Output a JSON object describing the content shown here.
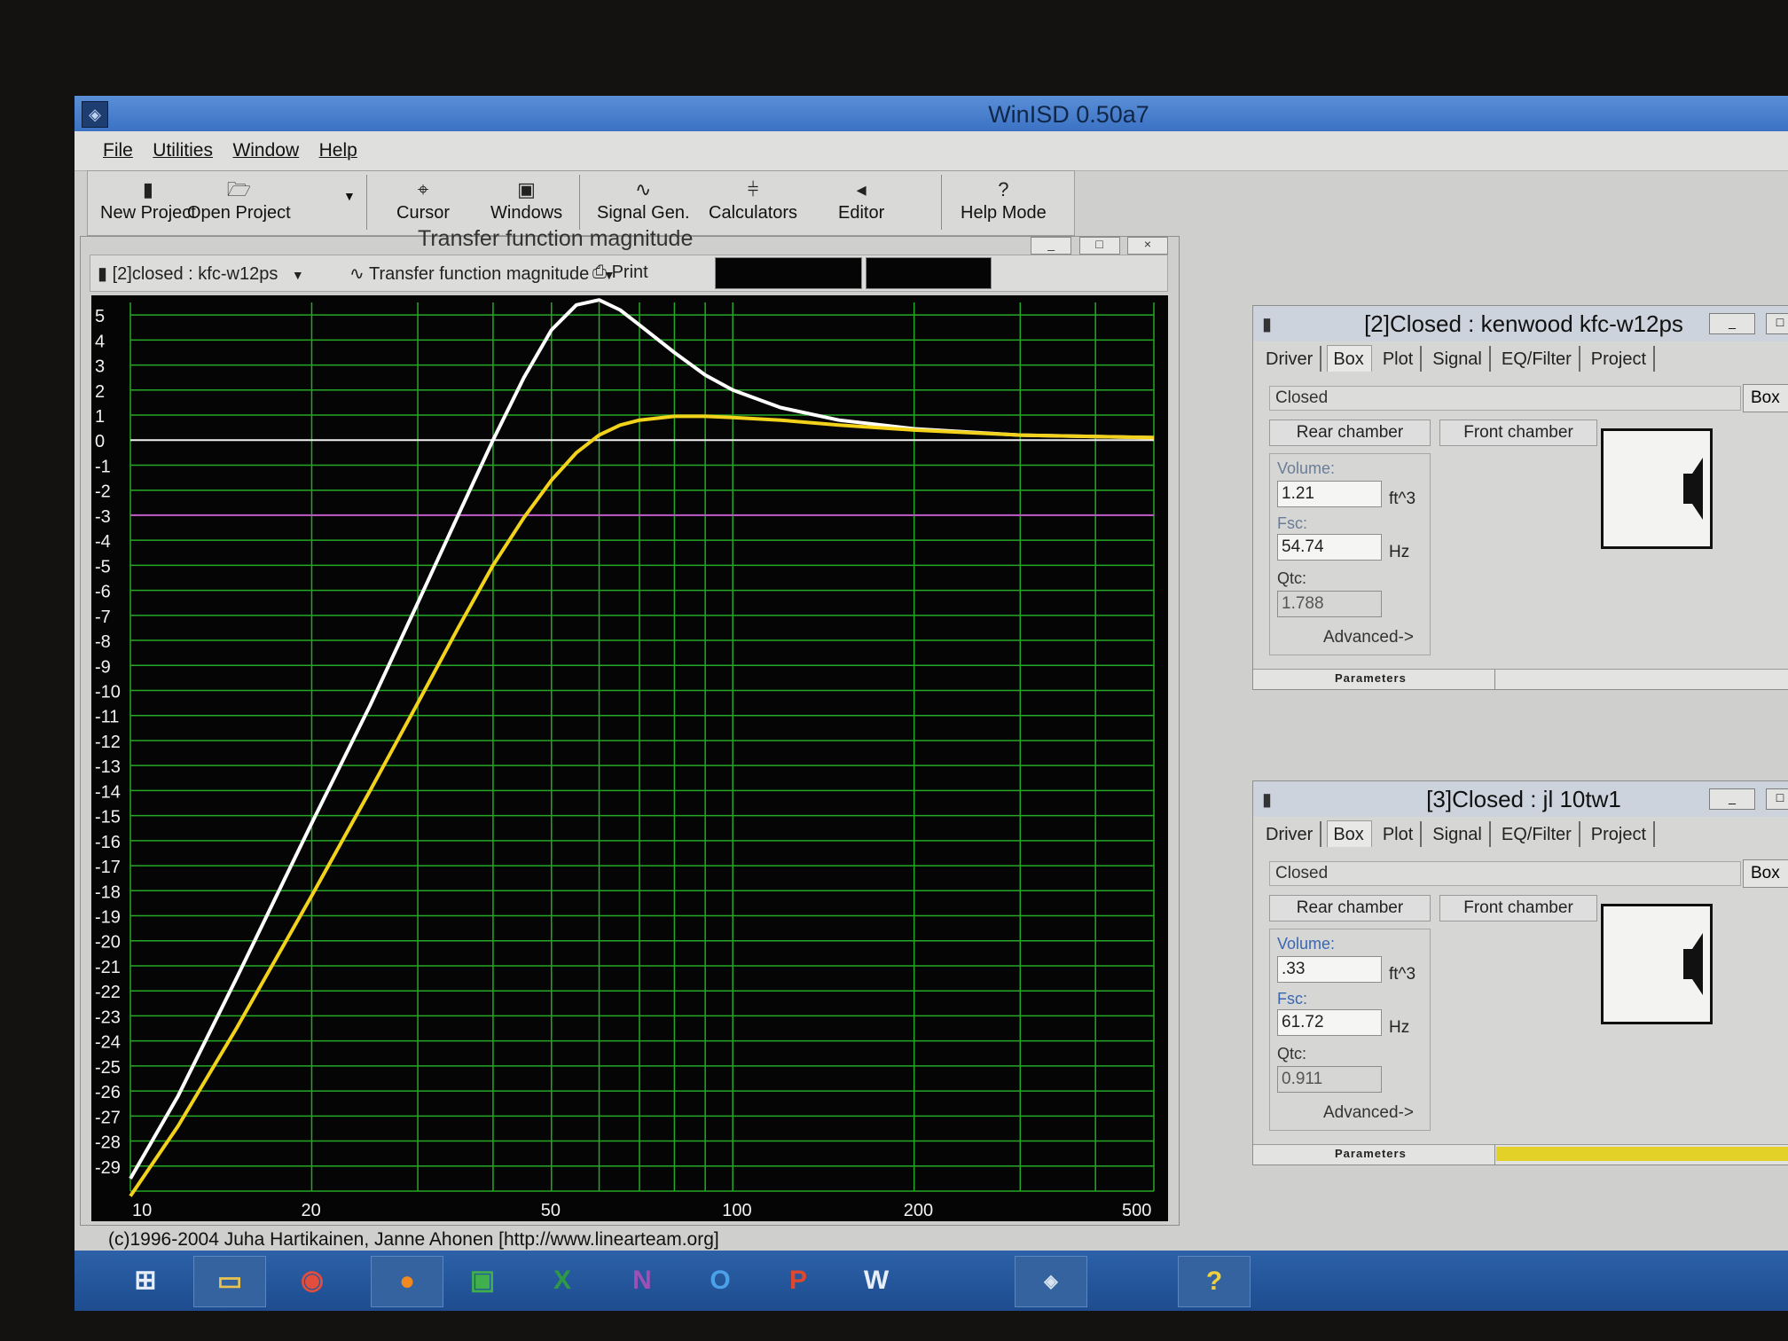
{
  "window": {
    "title": "WinISD 0.50a7"
  },
  "menu": [
    "File",
    "Utilities",
    "Window",
    "Help"
  ],
  "toolbar": {
    "new_project": "New Project",
    "open_project": "Open Project",
    "cursor": "Cursor",
    "windows": "Windows",
    "signal_gen": "Signal Gen.",
    "calculators": "Calculators",
    "editor": "Editor",
    "help_mode": "Help Mode"
  },
  "plot_window": {
    "title": "Transfer function magnitude",
    "project_select": "[2]closed : kfc-w12ps",
    "plot_type_select": "Transfer function magnitude",
    "print_label": "Print"
  },
  "chart_data": {
    "type": "line",
    "title": "Transfer function magnitude",
    "xscale": "log",
    "xlim": [
      10,
      500
    ],
    "ylim": [
      -30,
      5.5
    ],
    "x_tick_labels": [
      "10",
      "20",
      "50",
      "100",
      "200",
      "500"
    ],
    "y_tick_labels": [
      "5",
      "4",
      "3",
      "2",
      "1",
      "0",
      "-1",
      "-2",
      "-3",
      "-4",
      "-5",
      "-6",
      "-7",
      "-8",
      "-9",
      "-10",
      "-11",
      "-12",
      "-13",
      "-14",
      "-15",
      "-16",
      "-17",
      "-18",
      "-19",
      "-20",
      "-21",
      "-22",
      "-23",
      "-24",
      "-25",
      "-26",
      "-27",
      "-28",
      "-29"
    ],
    "grid": true,
    "reference_lines": [
      {
        "y": 0,
        "color": "#f0f0f0"
      },
      {
        "y": -3,
        "color": "#c05ac8"
      }
    ],
    "series": [
      {
        "color": "#ffffff",
        "x": [
          10,
          12,
          15,
          20,
          25,
          30,
          35,
          40,
          45,
          50,
          55,
          60,
          65,
          70,
          80,
          90,
          100,
          120,
          150,
          200,
          300,
          500
        ],
        "y": [
          -29.5,
          -26.2,
          -21.5,
          -15.3,
          -10.6,
          -6.5,
          -3.0,
          0.0,
          2.5,
          4.4,
          5.4,
          5.6,
          5.2,
          4.6,
          3.5,
          2.6,
          2.0,
          1.3,
          0.8,
          0.45,
          0.2,
          0.1
        ]
      },
      {
        "color": "#f2d21b",
        "x": [
          10,
          12,
          15,
          20,
          25,
          30,
          35,
          40,
          45,
          50,
          55,
          60,
          65,
          70,
          80,
          90,
          100,
          120,
          150,
          200,
          300,
          500
        ],
        "y": [
          -30.2,
          -27.4,
          -23.5,
          -18.2,
          -14.0,
          -10.5,
          -7.5,
          -5.0,
          -3.1,
          -1.6,
          -0.5,
          0.2,
          0.6,
          0.8,
          0.95,
          0.95,
          0.9,
          0.8,
          0.6,
          0.4,
          0.2,
          0.1
        ]
      }
    ]
  },
  "panels": [
    {
      "title": "[2]Closed : kenwood kfc-w12ps",
      "tabs": [
        "Driver",
        "Box",
        "Plot",
        "Signal",
        "EQ/Filter",
        "Project"
      ],
      "box_type": "Closed",
      "box_button": "Box",
      "rear_chamber": "Rear chamber",
      "front_chamber": "Front chamber",
      "volume_label": "Volume:",
      "volume_value": "1.21",
      "volume_unit": "ft^3",
      "fsc_label": "Fsc:",
      "fsc_value": "54.74",
      "fsc_unit": "Hz",
      "qtc_label": "Qtc:",
      "qtc_value": "1.788",
      "advanced": "Advanced->",
      "status": "Parameters"
    },
    {
      "title": "[3]Closed : jl 10tw1",
      "tabs": [
        "Driver",
        "Box",
        "Plot",
        "Signal",
        "EQ/Filter",
        "Project"
      ],
      "box_type": "Closed",
      "box_button": "Box",
      "rear_chamber": "Rear chamber",
      "front_chamber": "Front chamber",
      "volume_label": "Volume:",
      "volume_value": ".33",
      "volume_unit": "ft^3",
      "fsc_label": "Fsc:",
      "fsc_value": "61.72",
      "fsc_unit": "Hz",
      "qtc_label": "Qtc:",
      "qtc_value": "0.911",
      "advanced": "Advanced->",
      "status": "Parameters"
    }
  ],
  "status_bar": {
    "copyright": "(c)1996-2004 Juha Hartikainen, Janne Ahonen [http://www.linearteam.org]"
  },
  "taskbar": {
    "icons": [
      "windows-start-icon",
      "file-explorer-icon",
      "chrome-icon",
      "firefox-icon",
      "store-icon",
      "excel-icon",
      "onenote-icon",
      "outlook-icon",
      "powerpoint-icon",
      "word-icon",
      "winisd-icon",
      "help-icon"
    ]
  },
  "colors": {
    "plot_bg": "#050505",
    "grid": "#25a825",
    "accent_title": "#3b72c4"
  }
}
